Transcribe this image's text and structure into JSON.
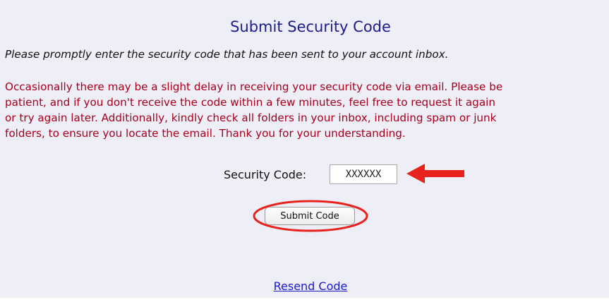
{
  "page": {
    "title": "Submit Security Code",
    "intro": "Please promptly enter the security code that has been sent to your account inbox.",
    "notice_lines": [
      "Occasionally there may be a slight delay in receiving your security code via email. Please be",
      "patient, and if you don't receive the code within a few minutes, feel free to request it again",
      "or try again later. Additionally, kindly check all folders in your inbox, including spam or junk",
      "folders, to ensure you locate the email. Thank you for your understanding."
    ]
  },
  "form": {
    "code_label": "Security Code:",
    "code_value": "XXXXXX",
    "submit_label": "Submit Code",
    "resend_label": "Resend Code"
  },
  "annotations": {
    "arrow_icon": "left-arrow-icon",
    "ring_icon": "highlight-ellipse",
    "color": "#e8231e"
  },
  "colors": {
    "title": "#1c1c8c",
    "notice": "#a8001c",
    "link": "#1a1ad0",
    "panel_background": "#eeeef7"
  }
}
